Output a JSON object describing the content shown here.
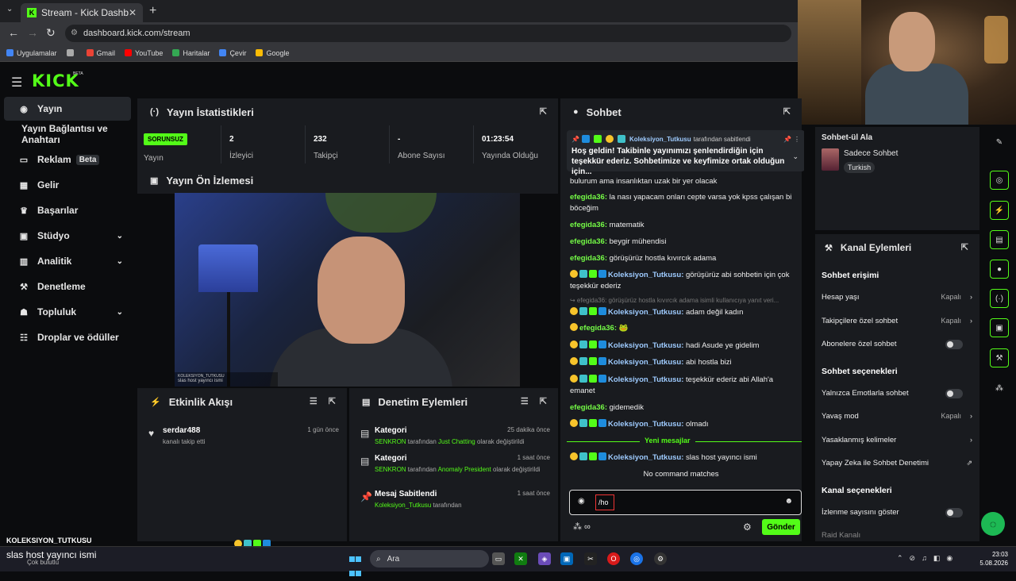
{
  "browser": {
    "tab_title": "Stream - Kick Dashboard",
    "tab_favicon": "K",
    "close": "✕",
    "new_tab": "+",
    "url": "dashboard.kick.com/stream",
    "bookmarks": [
      {
        "label": "Uygulamalar",
        "color": "#4285f4"
      },
      {
        "label": "",
        "color": "#aaaaaa"
      },
      {
        "label": "Gmail",
        "color": "#ea4335"
      },
      {
        "label": "YouTube",
        "color": "#ff0000"
      },
      {
        "label": "Haritalar",
        "color": "#34a853"
      },
      {
        "label": "Çevir",
        "color": "#4285f4"
      },
      {
        "label": "Google",
        "color": "#fbbc05"
      }
    ]
  },
  "kick": {
    "logo": "KICK",
    "beta": "BETA"
  },
  "sidebar": {
    "items": [
      {
        "label": "Yayın",
        "icon": "broadcast-icon",
        "glyph": "◉",
        "active": true
      },
      {
        "label": "Yayın Bağlantısı ve Anahtarı",
        "icon": "",
        "glyph": "",
        "active": false
      },
      {
        "label": "Reklam",
        "icon": "ad-icon",
        "glyph": "▭",
        "badge": "Beta"
      },
      {
        "label": "Gelir",
        "icon": "revenue-icon",
        "glyph": "▦"
      },
      {
        "label": "Başarılar",
        "icon": "trophy-icon",
        "glyph": "♛"
      },
      {
        "label": "Stüdyo",
        "icon": "studio-icon",
        "glyph": "▣",
        "chev": "⌄"
      },
      {
        "label": "Analitik",
        "icon": "analytics-icon",
        "glyph": "▥",
        "chev": "⌄"
      },
      {
        "label": "Denetleme",
        "icon": "moderation-icon",
        "glyph": "⚒"
      },
      {
        "label": "Topluluk",
        "icon": "community-icon",
        "glyph": "☗",
        "chev": "⌄"
      },
      {
        "label": "Droplar ve ödüller",
        "icon": "drops-icon",
        "glyph": "☷"
      }
    ]
  },
  "stats": {
    "title": "Yayın İstatistikleri",
    "status_badge": "SORUNSUZ",
    "status_label": "Yayın",
    "items": [
      {
        "value": "2",
        "label": "İzleyici"
      },
      {
        "value": "232",
        "label": "Takipçi"
      },
      {
        "value": "-",
        "label": "Abone Sayısı"
      },
      {
        "value": "01:23:54",
        "label": "Yayında Olduğu"
      }
    ]
  },
  "preview": {
    "title": "Yayın Ön İzlemesi",
    "overlay_line1": "KOLEKSIYON_TUTKUSU",
    "overlay_line2": "slas host yayıncı ismi"
  },
  "activity": {
    "title": "Etkinlik Akışı",
    "items": [
      {
        "user": "serdar488",
        "text": "kanalı takip etti",
        "time": "1 gün önce"
      }
    ]
  },
  "moderation": {
    "title": "Denetim Eylemleri",
    "items": [
      {
        "title": "Kategori",
        "user": "SENKRON",
        "mid": " tarafından ",
        "hl": "Just Chatting",
        "tail": " olarak değiştirildi",
        "time": "25 dakika önce"
      },
      {
        "title": "Kategori",
        "user": "SENKRON",
        "mid": " tarafından ",
        "hl": "Anomaly President",
        "tail": " olarak değiştirildi",
        "time": "1 saat önce"
      },
      {
        "title": "Mesaj Sabitlendi",
        "user": "Koleksiyon_Tutkusu",
        "mid": " tarafından",
        "hl": "",
        "tail": "",
        "time": "1 saat önce"
      }
    ]
  },
  "chat": {
    "title": "Sohbet",
    "pinned_user": "Koleksiyon_Tutkusu",
    "pinned_by": "tarafından sabitlendi",
    "pinned_msg": "Hoş geldin! Takibinle yayınımızı şenlendirdiğin için teşekkür ederiz. Sohbetimize ve keyfimize ortak olduğun için...",
    "messages": [
      {
        "user": "",
        "text": "bulurum ama insanlıktan uzak bir yer olacak",
        "cls": "u-efe",
        "badges": []
      },
      {
        "user": "efegida36",
        "text": "la nası yapacam onları cepte varsa yok kpss çalışan bi böceğim",
        "cls": "u-efe",
        "badges": []
      },
      {
        "user": "efegida36",
        "text": "matematik",
        "cls": "u-efe",
        "badges": []
      },
      {
        "user": "efegida36",
        "text": "beygir mühendisi",
        "cls": "u-efe",
        "badges": []
      },
      {
        "user": "efegida36",
        "text": "görüşürüz hostla kıvırcık adama",
        "cls": "u-efe",
        "badges": []
      },
      {
        "user": "Koleksiyon_Tutkusu",
        "text": "görüşürüz abi sohbetin için çok teşekkür ederiz",
        "cls": "u-kol",
        "badges": [
          "b-sub",
          "b-mod",
          "b-vip",
          "b-og"
        ]
      },
      {
        "user": "",
        "text": "↪ efegida36: görüşürüz hostla kıvırcık adama isimli kullanıcıya yanıt veri...",
        "cls": "",
        "badges": [],
        "reply": true
      },
      {
        "user": "Koleksiyon_Tutkusu",
        "text": "adam değil kadın",
        "cls": "u-kol",
        "badges": [
          "b-sub",
          "b-mod",
          "b-vip",
          "b-og"
        ]
      },
      {
        "user": "efegida36",
        "text": "🐸",
        "cls": "u-efe",
        "badges": [
          "b-sub"
        ]
      },
      {
        "user": "Koleksiyon_Tutkusu",
        "text": "hadi Asude ye gidelim",
        "cls": "u-kol",
        "badges": [
          "b-sub",
          "b-mod",
          "b-vip",
          "b-og"
        ]
      },
      {
        "user": "Koleksiyon_Tutkusu",
        "text": "abi hostla bizi",
        "cls": "u-kol",
        "badges": [
          "b-sub",
          "b-mod",
          "b-vip",
          "b-og"
        ]
      },
      {
        "user": "Koleksiyon_Tutkusu",
        "text": "teşekkür ederiz abi Allah'a emanet",
        "cls": "u-kol",
        "badges": [
          "b-sub",
          "b-mod",
          "b-vip",
          "b-og"
        ]
      },
      {
        "user": "efegida36",
        "text": "gidemedik",
        "cls": "u-efe",
        "badges": []
      },
      {
        "user": "Koleksiyon_Tutkusu",
        "text": "olmadı",
        "cls": "u-kol",
        "badges": [
          "b-sub",
          "b-mod",
          "b-vip",
          "b-og"
        ]
      },
      {
        "user": "Koleksiyon_Tutkusu",
        "text": "slas host yayıncı ismi",
        "cls": "u-kol",
        "badges": [
          "b-sub",
          "b-mod",
          "b-vip",
          "b-og"
        ]
      }
    ],
    "new_messages": "Yeni mesajlar",
    "no_command": "No command matches",
    "input_value": "/ho",
    "send": "Gönder"
  },
  "featured": {
    "title": "Sohbet-ül Ala",
    "name": "Sadece Sohbet",
    "tag": "Turkish"
  },
  "actions": {
    "title": "Kanal Eylemleri",
    "sections": [
      {
        "title": "Sohbet erişimi",
        "rows": [
          {
            "label": "Hesap yaşı",
            "value": "Kapalı",
            "type": "nav"
          },
          {
            "label": "Takipçilere özel sohbet",
            "value": "Kapalı",
            "type": "nav"
          },
          {
            "label": "Abonelere özel sohbet",
            "value": "",
            "type": "toggle"
          }
        ]
      },
      {
        "title": "Sohbet seçenekleri",
        "rows": [
          {
            "label": "Yalnızca Emotlarla sohbet",
            "value": "",
            "type": "toggle"
          },
          {
            "label": "Yavaş mod",
            "value": "Kapalı",
            "type": "nav"
          },
          {
            "label": "Yasaklanmış kelimeler",
            "value": "",
            "type": "nav"
          },
          {
            "label": "Yapay Zeka ile Sohbet Denetimi",
            "value": "",
            "type": "ext"
          }
        ]
      },
      {
        "title": "Kanal seçenekleri",
        "rows": [
          {
            "label": "İzlenme sayısını göster",
            "value": "",
            "type": "toggle"
          },
          {
            "label": "Raid Kanalı",
            "value": "",
            "type": "dim"
          }
        ]
      }
    ]
  },
  "overlay": {
    "user": "KOLEKSIYON_TUTKUSU",
    "message": "slas host yayıncı ismi"
  },
  "taskbar": {
    "weather": "Çok bulutlu",
    "search": "Ara",
    "time": "23:03",
    "date": "5.08.2026"
  }
}
